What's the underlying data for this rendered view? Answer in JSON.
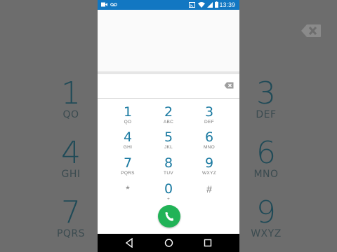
{
  "status_bar": {
    "time": "13:39",
    "left_icons": [
      "video-icon",
      "voicemail-icon"
    ],
    "right_icons": [
      "cast-icon",
      "wifi-icon",
      "signal-icon",
      "battery-icon"
    ]
  },
  "dial_input": {
    "value": ""
  },
  "keys": [
    {
      "digit": "1",
      "letters": "QO"
    },
    {
      "digit": "2",
      "letters": "ABC"
    },
    {
      "digit": "3",
      "letters": "DEF"
    },
    {
      "digit": "4",
      "letters": "GHI"
    },
    {
      "digit": "5",
      "letters": "JKL"
    },
    {
      "digit": "6",
      "letters": "MNO"
    },
    {
      "digit": "7",
      "letters": "PQRS"
    },
    {
      "digit": "8",
      "letters": "TUV"
    },
    {
      "digit": "9",
      "letters": "WXYZ"
    },
    {
      "digit": "*",
      "letters": ""
    },
    {
      "digit": "0",
      "letters": "+"
    },
    {
      "digit": "#",
      "letters": ""
    }
  ],
  "background_keys": {
    "k1": {
      "digit": "1",
      "letters": "QO"
    },
    "k3": {
      "digit": "3",
      "letters": "DEF"
    },
    "k4": {
      "digit": "4",
      "letters": "GHI"
    },
    "k6": {
      "digit": "6",
      "letters": "MNO"
    },
    "k7": {
      "digit": "7",
      "letters": "PQRS"
    },
    "k9": {
      "digit": "9",
      "letters": "WXYZ"
    }
  },
  "colors": {
    "status_bar": "#1277c2",
    "digit": "#1b7aa1",
    "call_button": "#21b357"
  }
}
